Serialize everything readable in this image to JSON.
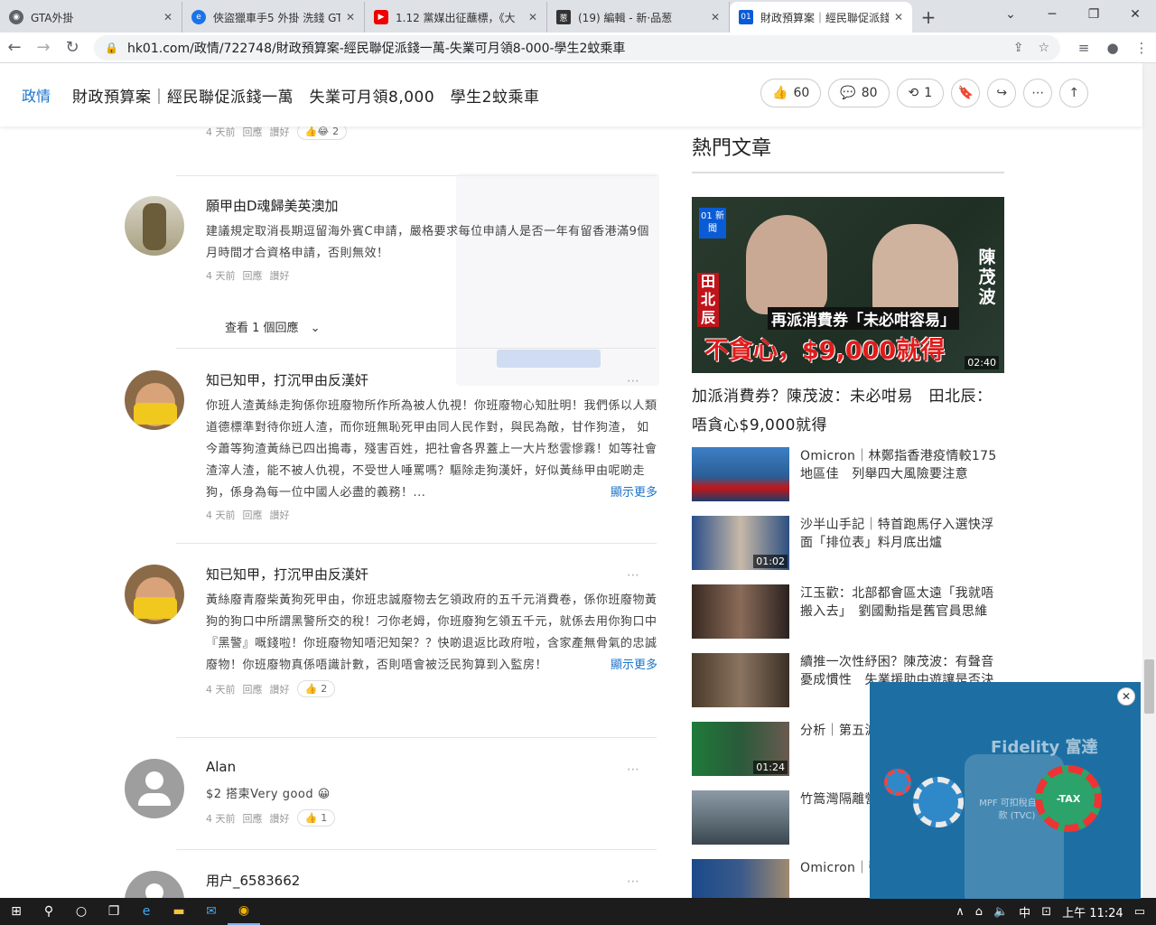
{
  "browser": {
    "tabs": [
      {
        "title": "GTA外掛",
        "color": "#5f6368",
        "active": false
      },
      {
        "title": "俠盜獵車手5 外掛 洗錢 GT",
        "color": "#1a73e8",
        "active": false
      },
      {
        "title": "1.12 黨媒出征蘸標，《大",
        "color": "#e00",
        "active": false
      },
      {
        "title": "(19) 編輯 - 新·品葱",
        "color": "#333",
        "active": false
      },
      {
        "title": "財政預算案｜經民聯促派錢",
        "color": "#0a5bd6",
        "active": true
      }
    ],
    "url": "hk01.com/政情/722748/財政預算案-經民聯促派錢一萬-失業可月領8-000-學生2蚊乘車"
  },
  "header": {
    "category": "政情",
    "title": "財政預算案｜經民聯促派錢一萬　失業可月領8,000　學生2蚊乘車",
    "likes": "60",
    "comments": "80",
    "shares": "1"
  },
  "comments": [
    {
      "meta_time": "4 天前",
      "reply": "回應",
      "report": "讚好",
      "reactions": "2"
    },
    {
      "name": "願甲由D魂歸美英澳加",
      "text": "建議規定取消長期逗留海外賓C申請，嚴格要求每位申請人是否一年有留香港滿9個月時間才合資格申請，否則無效！",
      "meta_time": "4 天前",
      "reply": "回應",
      "report": "讚好"
    },
    {
      "name": "知已知甲，打沉甲由反漢奸",
      "text": "你班人渣黃絲走狗係你班廢物所作所為被人仇視！你班廢物心知肚明！我們係以人類道德標準對待你班人渣，而你班無恥死甲由同人民作對，與民為敵，甘作狗渣， 如今蕭等狗渣黃絲已四出搗毒，殘害百姓，把社會各界蓋上一大片愁雲慘霧！如等社會渣滓人渣，能不被人仇視，不受世人唾罵嗎？驅除走狗漢奸，好似黃絲甲由呢啲走狗，係身為每一位中國人必盡的義務！...",
      "more": "顯示更多",
      "meta_time": "4 天前",
      "reply": "回應",
      "report": "讚好"
    },
    {
      "name": "知已知甲，打沉甲由反漢奸",
      "text": "黃絲廢青廢柴黃狗死甲由，你班忠誠廢物去乞領政府的五千元消費卷，係你班廢物黃狗的狗口中所謂黑警所交的稅！刁你老姆，你班廢狗乞領五千元，就係去用你狗口中『黑警』嘅錢啦！你班廢物知唔汜知架？？快啲退返比政府啦，含家產無骨氣的忠誠廢物！你班廢物真係唔識計數，否則唔會被泛民狗算到入監房！",
      "more": "顯示更多",
      "meta_time": "4 天前",
      "reply": "回應",
      "report": "讚好",
      "reactions": "2"
    },
    {
      "name": "Alan",
      "text": "$2 搭柬Very good 😀",
      "meta_time": "4 天前",
      "reply": "回應",
      "report": "讚好",
      "reactions": "1"
    },
    {
      "name": "用户_6583662"
    }
  ],
  "view_replies": "查看 1 個回應",
  "rail": {
    "heading": "熱門文章",
    "hero": {
      "logo": "01 新聞",
      "name_left": "田北辰",
      "name_right": "陳茂波",
      "caption1": "再派消費券「未必咁容易」",
      "caption2": "不貪心，$9,000就得",
      "duration": "02:40",
      "title": "加派消費券？陳茂波：未必咁易　田北辰：唔貪心$9,000就得"
    },
    "items": [
      {
        "text": "Omicron｜林鄭指香港疫情較175地區佳　列舉四大風險要注意",
        "duration": ""
      },
      {
        "text": "沙半山手記｜特首跑馬仔入選快浮面「排位表」料月底出爐",
        "duration": "01:02"
      },
      {
        "text": "江玉歡：北部都會區太遠「我就唔搬入去」　劉國勳指是舊官員思維",
        "duration": ""
      },
      {
        "text": "續推一次性紓困？陳茂波：有聲音憂成慣性　失業援助中遊讓是否決",
        "duration": ""
      },
      {
        "text": "分析｜第五波　泵水　預算案",
        "duration": "01:24"
      },
      {
        "text": "竹篙灣隔離營　改善檢疫中心",
        "duration": ""
      },
      {
        "text": "Omicron｜張　林鄭：市民請",
        "duration": ""
      }
    ]
  },
  "ad": {
    "brand": "Fidelity 富達",
    "text": "MPF 可扣稅自願供款 (TVC)",
    "badge": "-TAX"
  },
  "taskbar": {
    "time": "上午 11:24",
    "lang": "中"
  }
}
